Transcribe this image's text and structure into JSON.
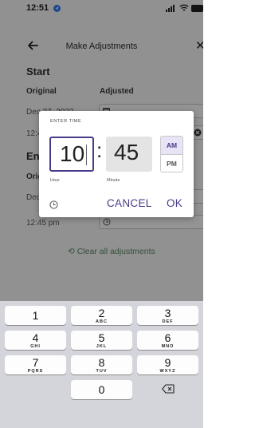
{
  "status_bar": {
    "time": "12:51"
  },
  "header": {
    "title": "Make Adjustments"
  },
  "start": {
    "heading": "Start",
    "original_label": "Original",
    "adjusted_label": "Adjusted",
    "original_date": "Dec 27, 2023",
    "original_time": "12:45 pm"
  },
  "end": {
    "heading": "End",
    "original_label": "Original",
    "original_date": "Dec 27, 2023",
    "original_time": "12:45 pm"
  },
  "clear_label": "Clear all adjustments",
  "time_dialog": {
    "title": "ENTER TIME",
    "hour": "10",
    "minute": "45",
    "hour_label": "Hour",
    "minute_label": "Minute",
    "am": "AM",
    "pm": "PM",
    "selected_period": "AM",
    "cancel": "CANCEL",
    "ok": "OK"
  },
  "keypad": {
    "keys": [
      {
        "num": "1",
        "letters": ""
      },
      {
        "num": "2",
        "letters": "ABC"
      },
      {
        "num": "3",
        "letters": "DEF"
      },
      {
        "num": "4",
        "letters": "GHI"
      },
      {
        "num": "5",
        "letters": "JKL"
      },
      {
        "num": "6",
        "letters": "MNO"
      },
      {
        "num": "7",
        "letters": "PQRS"
      },
      {
        "num": "8",
        "letters": "TUV"
      },
      {
        "num": "9",
        "letters": "WXYZ"
      },
      {
        "num": "0",
        "letters": ""
      }
    ]
  },
  "colors": {
    "accent": "#4a3a8a",
    "clear_link": "#5b8b66",
    "location_icon": "#2f7cf6"
  }
}
